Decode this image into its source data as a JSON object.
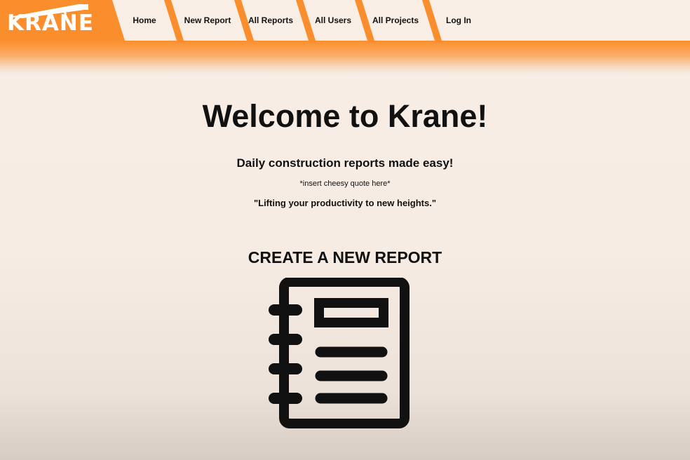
{
  "brand": {
    "logo_text": "KRANE",
    "accent_color": "#fb8e2c",
    "logo_color": "#ffffff"
  },
  "nav": {
    "items": [
      {
        "label": "Home"
      },
      {
        "label": "New Report"
      },
      {
        "label": "All Reports"
      },
      {
        "label": "All Users"
      },
      {
        "label": "All Projects"
      },
      {
        "label": "Log In"
      }
    ]
  },
  "main": {
    "title": "Welcome to Krane!",
    "tagline": "Daily construction reports made easy!",
    "placeholder_quote": "*insert cheesy quote here*",
    "quote": "\"Lifting your productivity to new heights.\"",
    "create_label": "CREATE A NEW REPORT",
    "create_icon": "notebook-icon"
  }
}
